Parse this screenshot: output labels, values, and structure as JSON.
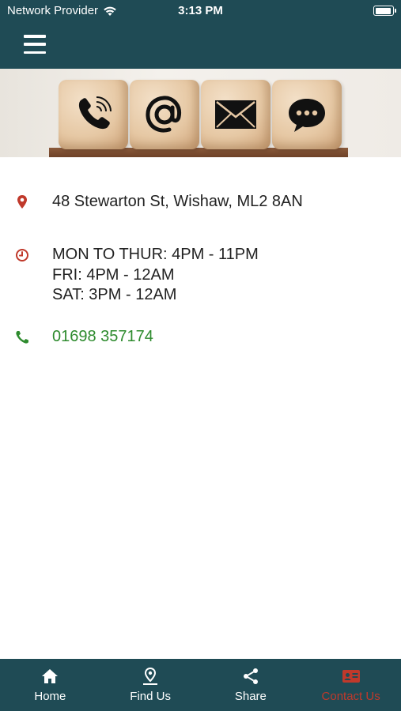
{
  "status_bar": {
    "carrier": "Network Provider",
    "time": "3:13 PM",
    "battery_level": 0.95
  },
  "header": {
    "menu_icon": "hamburger-menu-icon"
  },
  "banner": {
    "cube_icons": [
      "phone-icon",
      "at-sign-icon",
      "envelope-icon",
      "chat-bubble-icon"
    ]
  },
  "contact": {
    "address": "48 Stewarton St, Wishaw, ML2 8AN",
    "hours": [
      "MON TO THUR: 4PM - 11PM",
      "FRI: 4PM - 12AM",
      "SAT: 3PM - 12AM"
    ],
    "phone": "01698 357174"
  },
  "tabbar": {
    "tabs": [
      {
        "label": "Home",
        "icon": "home-icon"
      },
      {
        "label": "Find Us",
        "icon": "map-pin-icon"
      },
      {
        "label": "Share",
        "icon": "share-icon"
      },
      {
        "label": "Contact Us",
        "icon": "contact-card-icon"
      }
    ],
    "active_index": 3
  },
  "colors": {
    "header_bg": "#1f4b55",
    "accent_red": "#c0392b",
    "phone_green": "#2e8b2e",
    "text": "#222222"
  }
}
